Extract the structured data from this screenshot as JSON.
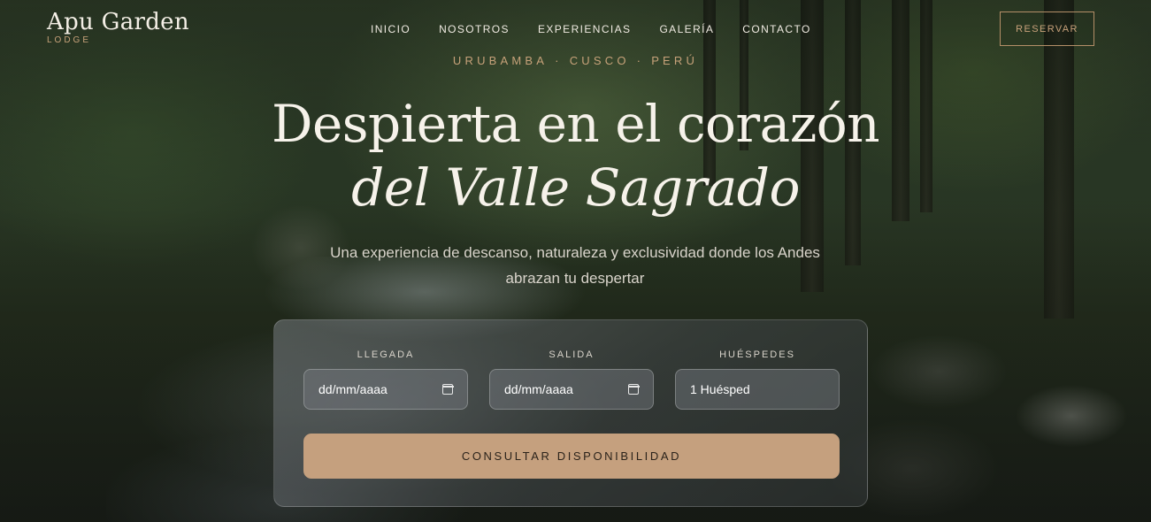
{
  "brand": {
    "name": "Apu Garden",
    "subtitle": "LODGE"
  },
  "nav": {
    "items": [
      "INICIO",
      "NOSOTROS",
      "EXPERIENCIAS",
      "GALERÍA",
      "CONTACTO"
    ]
  },
  "header": {
    "reserve_label": "RESERVAR"
  },
  "location": {
    "parts": [
      "URUBAMBA",
      "CUSCO",
      "PERÚ"
    ],
    "separator": "·"
  },
  "hero": {
    "title_line1": "Despierta en el corazón",
    "title_line2": "del Valle Sagrado",
    "subtitle": "Una experiencia de descanso, naturaleza y exclusividad donde los Andes abrazan tu despertar"
  },
  "booking": {
    "arrival_label": "LLEGADA",
    "arrival_value": "dd/mm/aaaa",
    "departure_label": "SALIDA",
    "departure_value": "dd/mm/aaaa",
    "guests_label": "HUÉSPEDES",
    "guests_value": "1 Huésped",
    "submit_label": "CONSULTAR DISPONIBILIDAD"
  },
  "colors": {
    "accent": "#c5a07e",
    "accent_text": "#c7a27a"
  },
  "icons": {
    "date_picker": "calendar-icon"
  }
}
